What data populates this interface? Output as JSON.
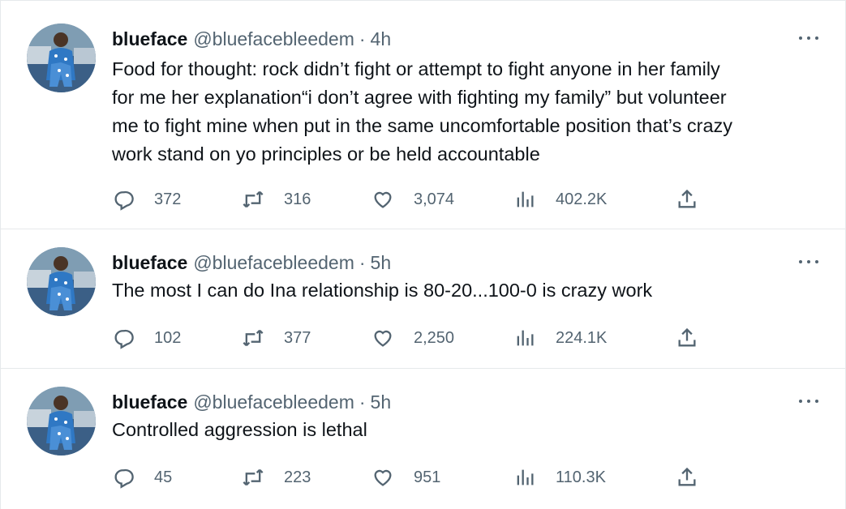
{
  "tweets": [
    {
      "name": "blueface",
      "handle": "@bluefacebleedem",
      "separator": "·",
      "time": "4h",
      "text": "Food for thought: rock didn’t fight or attempt to fight anyone in her family\nfor me her explanation“i don’t agree with fighting my family” but volunteer\nme to fight mine when put in the same uncomfortable position that’s crazy\nwork stand on yo principles or be held accountable",
      "replies": "372",
      "retweets": "316",
      "likes": "3,074",
      "views": "402.2K"
    },
    {
      "name": "blueface",
      "handle": "@bluefacebleedem",
      "separator": "·",
      "time": "5h",
      "text": "The most I can do Ina relationship is 80-20...100-0 is crazy work",
      "replies": "102",
      "retweets": "377",
      "likes": "2,250",
      "views": "224.1K"
    },
    {
      "name": "blueface",
      "handle": "@bluefacebleedem",
      "separator": "·",
      "time": "5h",
      "text": "Controlled aggression is lethal",
      "replies": "45",
      "retweets": "223",
      "likes": "951",
      "views": "110.3K"
    }
  ],
  "icons": {
    "reply": "reply-icon",
    "retweet": "retweet-icon",
    "like": "heart-icon",
    "views": "views-bar-chart-icon",
    "share": "share-icon",
    "more": "more-dots-icon"
  },
  "colors": {
    "text": "#0f1419",
    "secondary": "#536471",
    "divider": "#e6e9eb"
  }
}
